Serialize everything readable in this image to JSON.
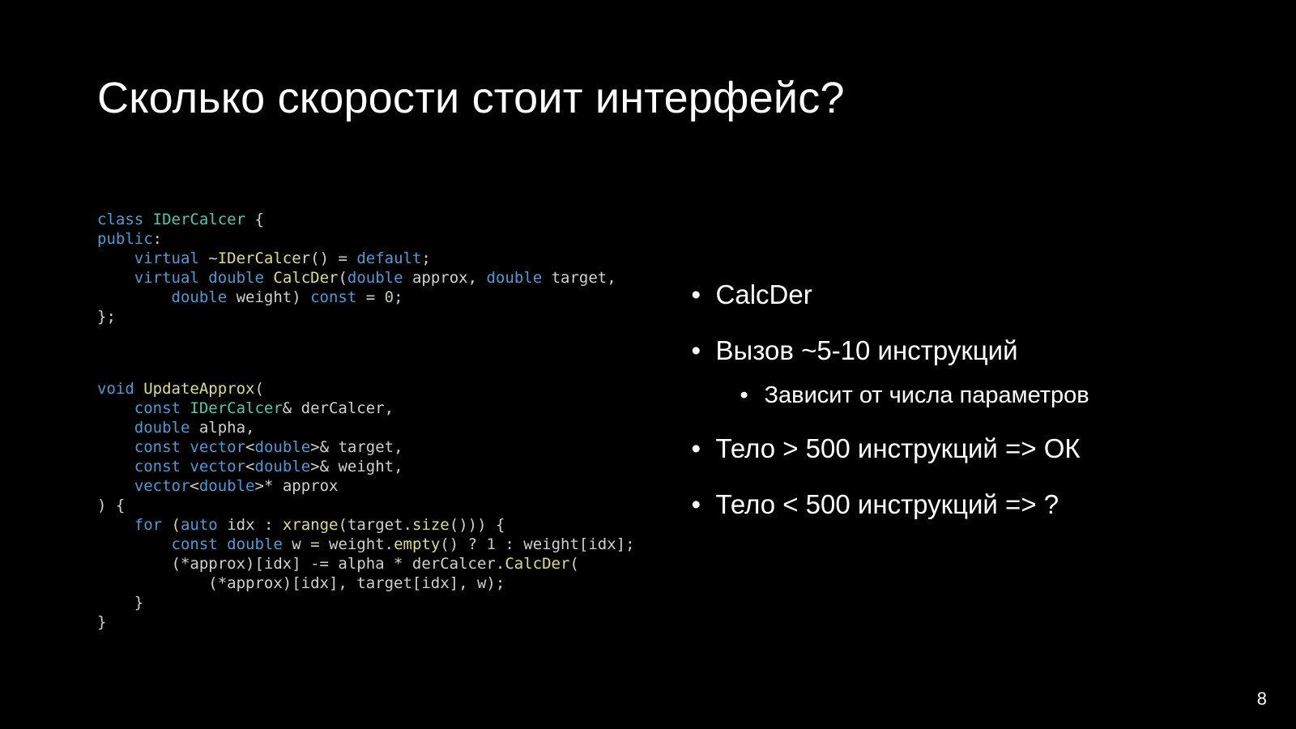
{
  "title": "Сколько скорости стоит интерфейс?",
  "page_number": "8",
  "code": {
    "block1": [
      [
        [
          "kw",
          "class "
        ],
        [
          "cls",
          "IDerCalcer"
        ],
        [
          "pun",
          " {"
        ]
      ],
      [
        [
          "kw",
          "public"
        ],
        [
          "pun",
          ":"
        ]
      ],
      [
        [
          "pun",
          "    "
        ],
        [
          "kw",
          "virtual "
        ],
        [
          "pun",
          "~"
        ],
        [
          "fn",
          "IDerCalcer"
        ],
        [
          "pun",
          "() = "
        ],
        [
          "kw",
          "default"
        ],
        [
          "pun",
          ";"
        ]
      ],
      [
        [
          "pun",
          "    "
        ],
        [
          "kw",
          "virtual "
        ],
        [
          "typ",
          "double"
        ],
        [
          "pun",
          " "
        ],
        [
          "fn",
          "CalcDer"
        ],
        [
          "pun",
          "("
        ],
        [
          "typ",
          "double"
        ],
        [
          "pun",
          " approx, "
        ],
        [
          "typ",
          "double"
        ],
        [
          "pun",
          " target,"
        ]
      ],
      [
        [
          "pun",
          "        "
        ],
        [
          "typ",
          "double"
        ],
        [
          "pun",
          " weight) "
        ],
        [
          "kw",
          "const"
        ],
        [
          "pun",
          " = "
        ],
        [
          "num",
          "0"
        ],
        [
          "pun",
          ";"
        ]
      ],
      [
        [
          "pun",
          "};"
        ]
      ]
    ],
    "block2": [
      [
        [
          "kw",
          "void "
        ],
        [
          "fn",
          "UpdateApprox"
        ],
        [
          "pun",
          "("
        ]
      ],
      [
        [
          "pun",
          "    "
        ],
        [
          "kw",
          "const "
        ],
        [
          "cls",
          "IDerCalcer"
        ],
        [
          "pun",
          "& derCalcer,"
        ]
      ],
      [
        [
          "pun",
          "    "
        ],
        [
          "typ",
          "double"
        ],
        [
          "pun",
          " alpha,"
        ]
      ],
      [
        [
          "pun",
          "    "
        ],
        [
          "kw",
          "const "
        ],
        [
          "typ",
          "vector"
        ],
        [
          "pun",
          "<"
        ],
        [
          "typ",
          "double"
        ],
        [
          "pun",
          ">& target,"
        ]
      ],
      [
        [
          "pun",
          "    "
        ],
        [
          "kw",
          "const "
        ],
        [
          "typ",
          "vector"
        ],
        [
          "pun",
          "<"
        ],
        [
          "typ",
          "double"
        ],
        [
          "pun",
          ">& weight,"
        ]
      ],
      [
        [
          "pun",
          "    "
        ],
        [
          "typ",
          "vector"
        ],
        [
          "pun",
          "<"
        ],
        [
          "typ",
          "double"
        ],
        [
          "pun",
          ">* approx"
        ]
      ],
      [
        [
          "pun",
          ") {"
        ]
      ],
      [
        [
          "pun",
          "    "
        ],
        [
          "kw",
          "for"
        ],
        [
          "pun",
          " ("
        ],
        [
          "kw",
          "auto"
        ],
        [
          "pun",
          " idx : "
        ],
        [
          "fn",
          "xrange"
        ],
        [
          "pun",
          "(target."
        ],
        [
          "fn",
          "size"
        ],
        [
          "pun",
          "())) {"
        ]
      ],
      [
        [
          "pun",
          "        "
        ],
        [
          "kw",
          "const "
        ],
        [
          "typ",
          "double"
        ],
        [
          "pun",
          " w = weight."
        ],
        [
          "fn",
          "empty"
        ],
        [
          "pun",
          "() ? "
        ],
        [
          "num",
          "1"
        ],
        [
          "pun",
          " : weight[idx];"
        ]
      ],
      [
        [
          "pun",
          "        (*approx)[idx] -= alpha * derCalcer."
        ],
        [
          "fn",
          "CalcDer"
        ],
        [
          "pun",
          "("
        ]
      ],
      [
        [
          "pun",
          "            (*approx)[idx], target[idx], w);"
        ]
      ],
      [
        [
          "pun",
          "    }"
        ]
      ],
      [
        [
          "pun",
          "}"
        ]
      ]
    ]
  },
  "bullets": [
    {
      "text": "CalcDer"
    },
    {
      "text": "Вызов ~5-10 инструкций",
      "sub": [
        "Зависит от числа параметров"
      ]
    },
    {
      "text": "Тело > 500 инструкций => ОК"
    },
    {
      "text": "Тело < 500 инструкций => ?"
    }
  ]
}
